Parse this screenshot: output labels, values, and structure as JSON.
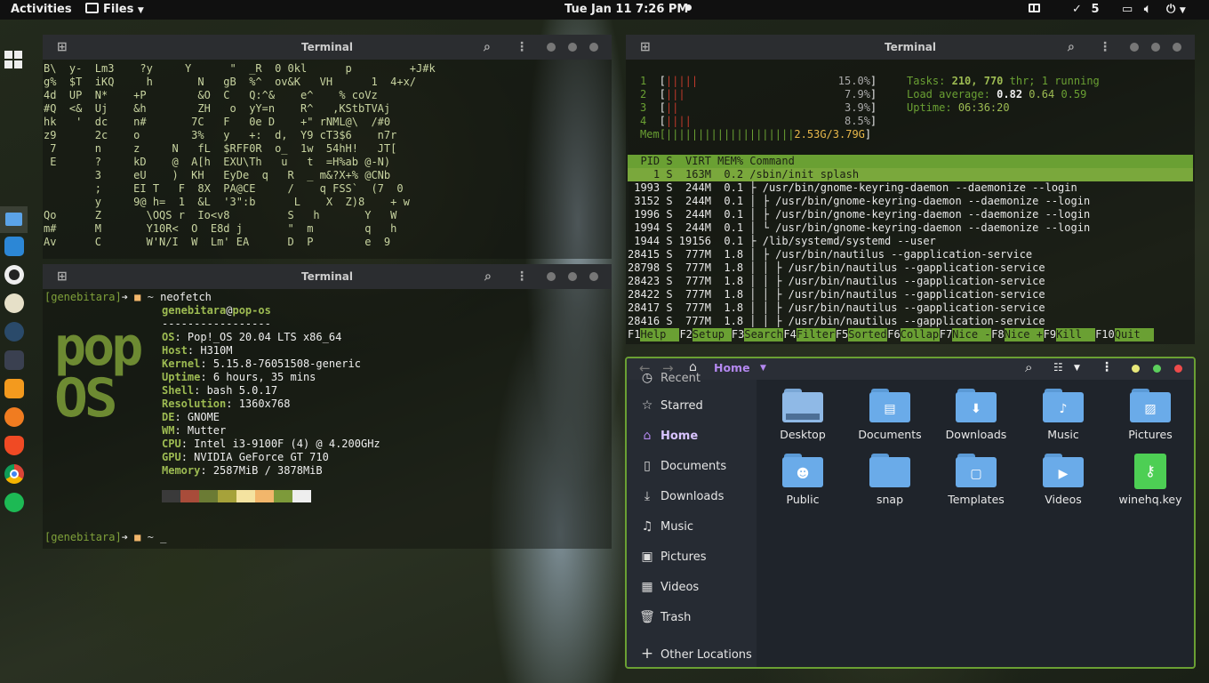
{
  "topbar": {
    "activities": "Activities",
    "app_menu": "Files",
    "clock": "Tue Jan 11  7:26 PM",
    "updates_count": "5"
  },
  "terminal1": {
    "title": "Terminal",
    "rain": [
      "B\\  y-  Lm3    ?y     Y      \"  _R  0 0kl      p         +J#k",
      "g%  $T  iKQ     h       N   gB  %^  ov&K   VH      1  4+x/",
      "4d  UP  N*    +P        &O  C   Q:^&    e^    % coVz",
      "#Q  <&  Uj    &h        ZH   o  yY=n    R^   ,KStbTVAj",
      "hk   '  dc    n#       7C   F   0e D    +\" rNML@\\  /#0",
      "z9      2c    o        3%   y   +:  d,  Y9 cT3$6    n7r",
      " 7      n     z     N   fL  $RFF0R  o_  1w  54hH!   JT[",
      " E      ?     kD    @  A[h  EXU\\Th   u   t  =H%ab @-N)",
      "        3     eU    )  KH   EyDe  q   R  _ m&?X+% @CNb",
      "        ;     EI T   F  8X  PA@CE     /    q FSS`  (7  0",
      "        y     9@ h=  1  &L  '3\":b      L    X  Z)8    + w",
      "Qo      Z       \\OQS r  Io<v8         S   h       Y   W",
      "m#      M       Y10R<  O  E8d j       \"  m        q   h",
      "Av      C       W'N/I  W  Lm' EA      D  P        e  9"
    ]
  },
  "terminal2": {
    "title": "Terminal",
    "prompt_user": "[genebitara]",
    "prompt_arrow": "➔",
    "prompt_folder": "■",
    "prompt_tilde": "~",
    "command": "neofetch",
    "cursor": "_",
    "userhost_user": "genebitara",
    "userhost_at": "@",
    "userhost_host": "pop-os",
    "separator": "-----------------",
    "logo": [
      "pop",
      "OS"
    ],
    "info": [
      {
        "k": "OS",
        "v": "Pop!_OS 20.04 LTS x86_64"
      },
      {
        "k": "Host",
        "v": "H310M"
      },
      {
        "k": "Kernel",
        "v": "5.15.8-76051508-generic"
      },
      {
        "k": "Uptime",
        "v": "6 hours, 35 mins"
      },
      {
        "k": "Shell",
        "v": "bash 5.0.17"
      },
      {
        "k": "Resolution",
        "v": "1360x768"
      },
      {
        "k": "DE",
        "v": "GNOME"
      },
      {
        "k": "WM",
        "v": "Mutter"
      },
      {
        "k": "CPU",
        "v": "Intel i3-9100F (4) @ 4.200GHz"
      },
      {
        "k": "GPU",
        "v": "NVIDIA GeForce GT 710"
      },
      {
        "k": "Memory",
        "v": "2587MiB / 3878MiB"
      }
    ],
    "palette": [
      "#3a3a3a",
      "#a84c3a",
      "#6b7b34",
      "#a6a23a",
      "#f4e3a0",
      "#f2b66b",
      "#7d9a3a",
      "#eeeeee"
    ]
  },
  "htop": {
    "title": "Terminal",
    "cpus": [
      {
        "n": "1",
        "bar": "|||||",
        "pct": "15.0%"
      },
      {
        "n": "2",
        "bar": "|||",
        "pct": "7.9%"
      },
      {
        "n": "3",
        "bar": "||",
        "pct": "3.9%"
      },
      {
        "n": "4",
        "bar": "||||",
        "pct": "8.5%"
      }
    ],
    "mem": {
      "label": "Mem",
      "bar": "||||||||||||||||||||",
      "val": "2.53G/3.79G"
    },
    "tasks_label": "Tasks:",
    "tasks_val": "210, 770",
    "tasks_rest": "thr; 1 running",
    "load_label": "Load average:",
    "load1": "0.82",
    "load5": "0.64",
    "load15": "0.59",
    "uptime_label": "Uptime:",
    "uptime_val": "06:36:20",
    "header": "  PID S  VIRT MEM% Command",
    "rows": [
      "    1 S  163M  0.2 /sbin/init splash",
      " 1993 S  244M  0.1 ├ /usr/bin/gnome-keyring-daemon --daemonize --login",
      " 3152 S  244M  0.1 │ ├ /usr/bin/gnome-keyring-daemon --daemonize --login",
      " 1996 S  244M  0.1 │ ├ /usr/bin/gnome-keyring-daemon --daemonize --login",
      " 1994 S  244M  0.1 │ └ /usr/bin/gnome-keyring-daemon --daemonize --login",
      " 1944 S 19156  0.1 ├ /lib/systemd/systemd --user",
      "28415 S  777M  1.8 │ ├ /usr/bin/nautilus --gapplication-service",
      "28798 S  777M  1.8 │ │ ├ /usr/bin/nautilus --gapplication-service",
      "28423 S  777M  1.8 │ │ ├ /usr/bin/nautilus --gapplication-service",
      "28422 S  777M  1.8 │ │ ├ /usr/bin/nautilus --gapplication-service",
      "28417 S  777M  1.8 │ │ ├ /usr/bin/nautilus --gapplication-service",
      "28416 S  777M  1.8 │ │ ├ /usr/bin/nautilus --gapplication-service"
    ],
    "fkeys": [
      {
        "k": "F1",
        "l": "Help"
      },
      {
        "k": "F2",
        "l": "Setup"
      },
      {
        "k": "F3",
        "l": "Search"
      },
      {
        "k": "F4",
        "l": "Filter"
      },
      {
        "k": "F5",
        "l": "Sorted"
      },
      {
        "k": "F6",
        "l": "Collap"
      },
      {
        "k": "F7",
        "l": "Nice -"
      },
      {
        "k": "F8",
        "l": "Nice +"
      },
      {
        "k": "F9",
        "l": "Kill"
      },
      {
        "k": "F10",
        "l": "Quit"
      }
    ]
  },
  "files": {
    "location": "Home",
    "sidebar": [
      "Recent",
      "Starred",
      "Home",
      "Documents",
      "Downloads",
      "Music",
      "Pictures",
      "Videos",
      "Trash",
      "Other Locations"
    ],
    "items": [
      "Desktop",
      "Documents",
      "Downloads",
      "Music",
      "Pictures",
      "Public",
      "snap",
      "Templates",
      "Videos",
      "winehq.key"
    ]
  },
  "colors": {
    "accent_green": "#6aa033",
    "htop_bar_green": "#6aa033",
    "files_accent": "#b488f0",
    "prompt_green": "#7fa13a"
  }
}
